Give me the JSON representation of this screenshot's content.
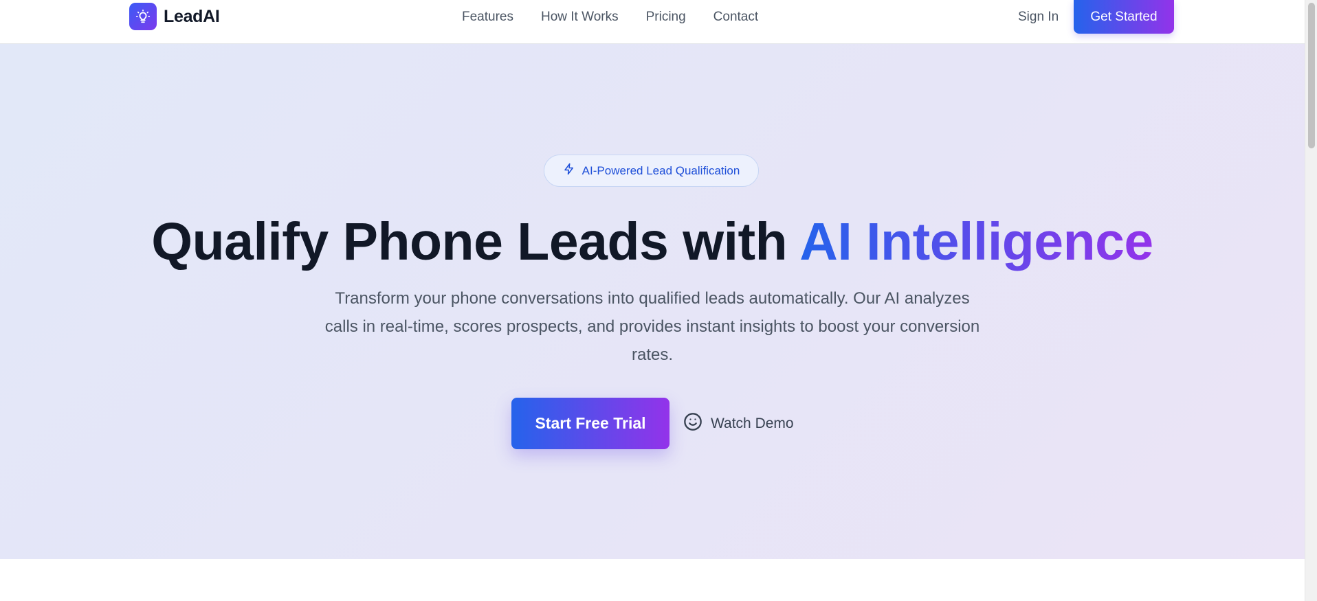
{
  "header": {
    "brand": "LeadAI",
    "logo_icon": "lightbulb-icon",
    "nav": [
      {
        "label": "Features"
      },
      {
        "label": "How It Works"
      },
      {
        "label": "Pricing"
      },
      {
        "label": "Contact"
      }
    ],
    "sign_in_label": "Sign In",
    "cta_label": "Get Started"
  },
  "hero": {
    "badge_icon": "lightning-bolt-icon",
    "badge_text": "AI-Powered Lead Qualification",
    "headline_plain": "Qualify Phone Leads with ",
    "headline_accent": "AI Intelligence",
    "subtitle": "Transform your phone conversations into qualified leads automatically. Our AI analyzes calls in real-time, scores prospects, and provides instant insights to boost your conversion rates.",
    "primary_cta_label": "Start Free Trial",
    "secondary_cta_icon": "smile-icon",
    "secondary_cta_label": "Watch Demo"
  },
  "colors": {
    "accent_start": "#2563eb",
    "accent_end": "#9333ea",
    "text_dark": "#111827",
    "text_muted": "#4b5563",
    "badge_text": "#1d4ed8"
  }
}
